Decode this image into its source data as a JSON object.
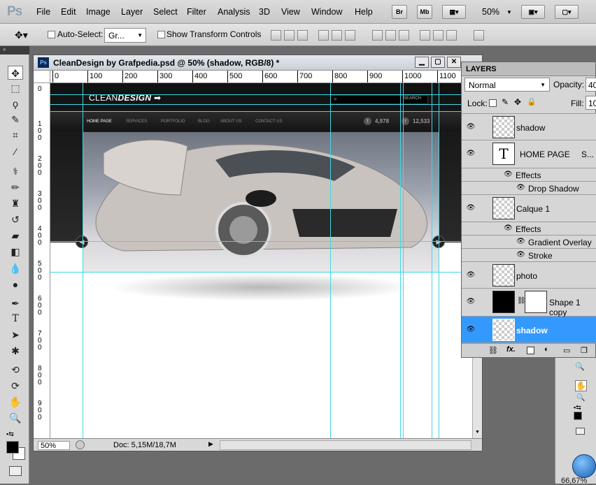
{
  "app": {
    "logo": "Ps"
  },
  "menu": {
    "items": [
      "File",
      "Edit",
      "Image",
      "Layer",
      "Select",
      "Filter",
      "Analysis",
      "3D",
      "View",
      "Window",
      "Help"
    ],
    "bridge": "Br",
    "minibridge": "Mb",
    "zoom": "50%"
  },
  "options": {
    "auto_select_label": "Auto-Select:",
    "auto_select_value": "Gr...",
    "transform_label": "Show Transform Controls"
  },
  "document": {
    "title": "CleanDesign by Grafpedia.psd @ 50% (shadow, RGB/8) *",
    "ruler_h": [
      "0",
      "100",
      "200",
      "300",
      "400",
      "500",
      "600",
      "700",
      "800",
      "900",
      "1000",
      "1100"
    ],
    "ruler_v": [
      "0",
      "1 0 0",
      "2 0 0",
      "3 0 0",
      "4 0 0",
      "5 0 0",
      "6 0 0",
      "7 0 0",
      "8 0 0",
      "9 0 0"
    ],
    "status_zoom": "50%",
    "status_doc": "Doc: 5,15M/18,7M"
  },
  "site": {
    "logo_clean": "CLEAN",
    "logo_design": "DESIGN",
    "search_button": "SEARCH",
    "nav": [
      "HOME PAGE",
      "SERVICES",
      "PORTFOLIO",
      "BLOG",
      "ABOUT US",
      "CONTACT US"
    ],
    "twitter_count": "4,978",
    "rss_count": "12,533"
  },
  "layers": {
    "tab": "LAYERS",
    "blend_mode": "Normal",
    "opacity_label": "Opacity:",
    "opacity_value": "40",
    "lock_label": "Lock:",
    "fill_label": "Fill:",
    "fill_value": "10",
    "effects_label": "Effects",
    "rows": [
      {
        "name": "shadow"
      },
      {
        "name": "HOME PAGE",
        "trail": "S..."
      },
      {
        "name": "Drop Shadow"
      },
      {
        "name": "Calque 1"
      },
      {
        "name": "Gradient Overlay"
      },
      {
        "name": "Stroke"
      },
      {
        "name": "photo"
      },
      {
        "name": "Shape 1 copy"
      },
      {
        "name": "shadow"
      }
    ]
  },
  "taskbar": {
    "zoom": "66,67%"
  },
  "colors": {
    "guide": "#3fd8e6",
    "selection": "#3399ff"
  }
}
